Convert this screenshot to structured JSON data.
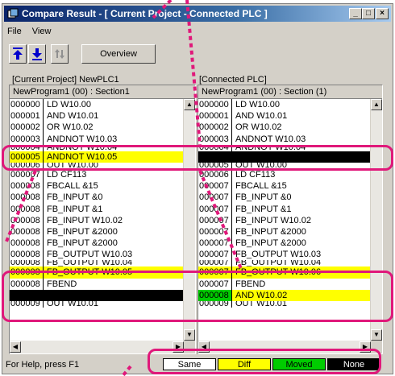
{
  "window": {
    "title": "Compare Result - [ Current Project - Connected PLC ]",
    "controls": {
      "minimize": "_",
      "maximize": "□",
      "close": "×"
    }
  },
  "menu": {
    "file": "File",
    "view": "View"
  },
  "toolbar": {
    "overview_label": "Overview"
  },
  "left": {
    "title": "[Current Project] NewPLC1",
    "header": "NewProgram1 (00) : Section1",
    "rows": [
      {
        "addr": "000000",
        "ins": "LD W10.00",
        "state": "same"
      },
      {
        "addr": "000001",
        "ins": "AND W10.01",
        "state": "same"
      },
      {
        "addr": "000002",
        "ins": "OR W10.02",
        "state": "same"
      },
      {
        "addr": "000003",
        "ins": "ANDNOT W10.03",
        "state": "same"
      },
      {
        "addr": "000004",
        "ins": "ANDNOT W10.04",
        "state": "cut"
      },
      {
        "addr": "000005",
        "ins": "ANDNOT W10.05",
        "state": "diff"
      },
      {
        "addr": "000006",
        "ins": "OUT W10.00",
        "state": "cut"
      },
      {
        "addr": "000007",
        "ins": "LD CF113",
        "state": "same"
      },
      {
        "addr": "000008",
        "ins": "FBCALL &15",
        "state": "same"
      },
      {
        "addr": "000008",
        "ins": "FB_INPUT &0",
        "state": "same"
      },
      {
        "addr": "000008",
        "ins": "FB_INPUT &1",
        "state": "same"
      },
      {
        "addr": "000008",
        "ins": "FB_INPUT W10.02",
        "state": "same"
      },
      {
        "addr": "000008",
        "ins": "FB_INPUT &2000",
        "state": "same"
      },
      {
        "addr": "000008",
        "ins": "FB_INPUT &2000",
        "state": "same"
      },
      {
        "addr": "000008",
        "ins": "FB_OUTPUT W10.03",
        "state": "same"
      },
      {
        "addr": "000008",
        "ins": "FB_OUTPUT W10.04",
        "state": "cut"
      },
      {
        "addr": "000008",
        "ins": "FB_OUTPUT W10.05",
        "state": "diff"
      },
      {
        "addr": "000008",
        "ins": "FBEND",
        "state": "same"
      },
      {
        "addr": "",
        "ins": "",
        "state": "none"
      },
      {
        "addr": "000009",
        "ins": "OUT W10.01",
        "state": "cut"
      }
    ]
  },
  "right": {
    "title": "[Connected PLC]",
    "header": "NewProgram1 (00) : Section (1)",
    "rows": [
      {
        "addr": "000000",
        "ins": "LD W10.00",
        "state": "same"
      },
      {
        "addr": "000001",
        "ins": "AND W10.01",
        "state": "same"
      },
      {
        "addr": "000002",
        "ins": "OR W10.02",
        "state": "same"
      },
      {
        "addr": "000003",
        "ins": "ANDNOT W10.03",
        "state": "same"
      },
      {
        "addr": "000004",
        "ins": "ANDNOT W10.04",
        "state": "cut"
      },
      {
        "addr": "",
        "ins": "",
        "state": "none"
      },
      {
        "addr": "000005",
        "ins": "OUT W10.00",
        "state": "cut"
      },
      {
        "addr": "000006",
        "ins": "LD CF113",
        "state": "same"
      },
      {
        "addr": "000007",
        "ins": "FBCALL &15",
        "state": "same"
      },
      {
        "addr": "000007",
        "ins": "FB_INPUT &0",
        "state": "same"
      },
      {
        "addr": "000007",
        "ins": "FB_INPUT &1",
        "state": "same"
      },
      {
        "addr": "000007",
        "ins": "FB_INPUT W10.02",
        "state": "same"
      },
      {
        "addr": "000007",
        "ins": "FB_INPUT &2000",
        "state": "same"
      },
      {
        "addr": "000007",
        "ins": "FB_INPUT &2000",
        "state": "same"
      },
      {
        "addr": "000007",
        "ins": "FB_OUTPUT W10.03",
        "state": "same"
      },
      {
        "addr": "000007",
        "ins": "FB_OUTPUT W10.04",
        "state": "cut"
      },
      {
        "addr": "000007",
        "ins": "FB_OUTPUT W10.06",
        "state": "diff"
      },
      {
        "addr": "000007",
        "ins": "FBEND",
        "state": "same"
      },
      {
        "addr": "000008",
        "ins": "AND W10.02",
        "state": "moved"
      },
      {
        "addr": "000009",
        "ins": "OUT W10.01",
        "state": "cut"
      }
    ]
  },
  "status": {
    "help_text": "For Help, press F1",
    "legend": [
      {
        "label": "Same",
        "bg": "#ffffff",
        "fg": "#000000"
      },
      {
        "label": "Diff",
        "bg": "#ffff00",
        "fg": "#000000"
      },
      {
        "label": "Moved",
        "bg": "#00cc00",
        "fg": "#000000"
      },
      {
        "label": "None",
        "bg": "#000000",
        "fg": "#ffffff"
      }
    ]
  },
  "colors": {
    "highlight": "#e0187a",
    "diff": "#ffff00",
    "moved": "#00cc00",
    "none": "#000000"
  }
}
